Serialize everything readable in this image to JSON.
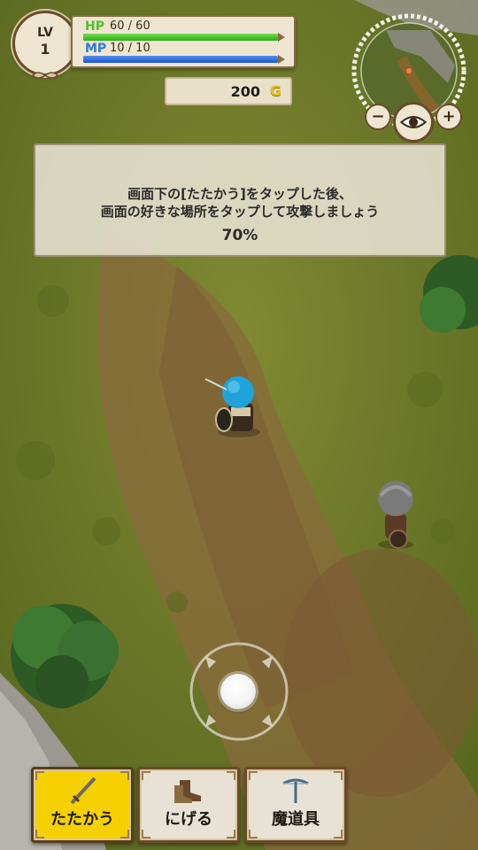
{
  "hud": {
    "level": {
      "label": "LV",
      "value": "1"
    },
    "hp": {
      "label": "HP",
      "text": "60 / 60",
      "fraction": 1.0
    },
    "mp": {
      "label": "MP",
      "text": "10 / 10",
      "fraction": 1.0
    },
    "gold": {
      "amount": "200",
      "symbol": "G"
    }
  },
  "minimap": {
    "zoom_out_label": "−",
    "zoom_in_label": "+",
    "eye_icon": "eye-icon"
  },
  "tutorial": {
    "line1": "画面下の[たたかう]をタップした後、",
    "line2": "画面の好きな場所をタップして攻撃しましょう",
    "progress_text": "70%"
  },
  "actions": {
    "attack": {
      "label": "たたかう",
      "icon": "sword-icon"
    },
    "flee": {
      "label": "にげる",
      "icon": "boots-icon"
    },
    "magic": {
      "label": "魔道具",
      "icon": "crossbow-icon"
    }
  },
  "colors": {
    "attack_active": "#f6d000",
    "panel_bg": "#efe6d2",
    "frame": "#6b4a2b",
    "hp_green": "#2da81a",
    "mp_blue": "#1f58c8"
  }
}
